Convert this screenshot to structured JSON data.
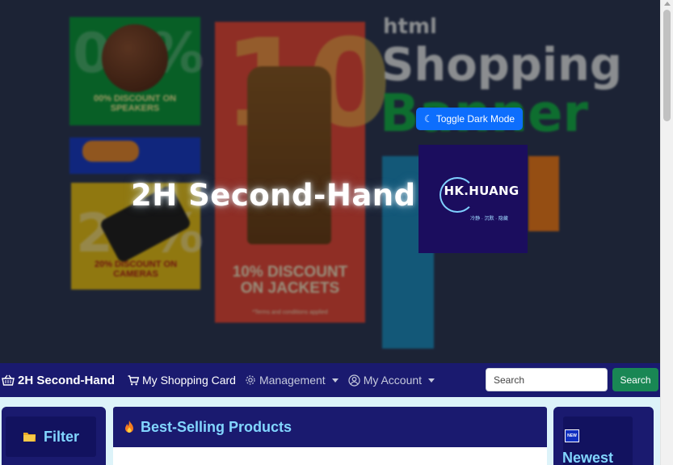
{
  "hero": {
    "title": "2H Second-Hand",
    "toggle_label": "Toggle Dark Mode",
    "logo_text": "HK.HUANG",
    "logo_sub": "冷静 · 沉默 · 隐藏",
    "banner": {
      "headline_1": "html",
      "headline_2": "Shopping",
      "headline_3": "Banner",
      "poster_1_num": "00%",
      "poster_1_text": "00% DISCOUNT ON SPEAKERS",
      "poster_2_num": "20%",
      "poster_2_text": "20% DISCOUNT ON CAMERAS",
      "poster_3_num": "10",
      "poster_3_text": "10% DISCOUNT ON JACKETS",
      "poster_3_small": "*Terms and conditions applied"
    }
  },
  "navbar": {
    "brand": "2H Second-Hand",
    "cart": "My Shopping Card",
    "management": "Management",
    "account": "My Account",
    "search_placeholder": "Search",
    "search_button": "Search"
  },
  "content": {
    "filter_label": "Filter",
    "best_label": "Best-Selling Products",
    "new_badge": "NEW",
    "newest_label": "Newest"
  },
  "colors": {
    "navbar_bg": "#1a1a6f",
    "accent_text": "#82d6ff",
    "toggle_bg": "#0d6efd",
    "search_btn_bg": "#198754"
  }
}
